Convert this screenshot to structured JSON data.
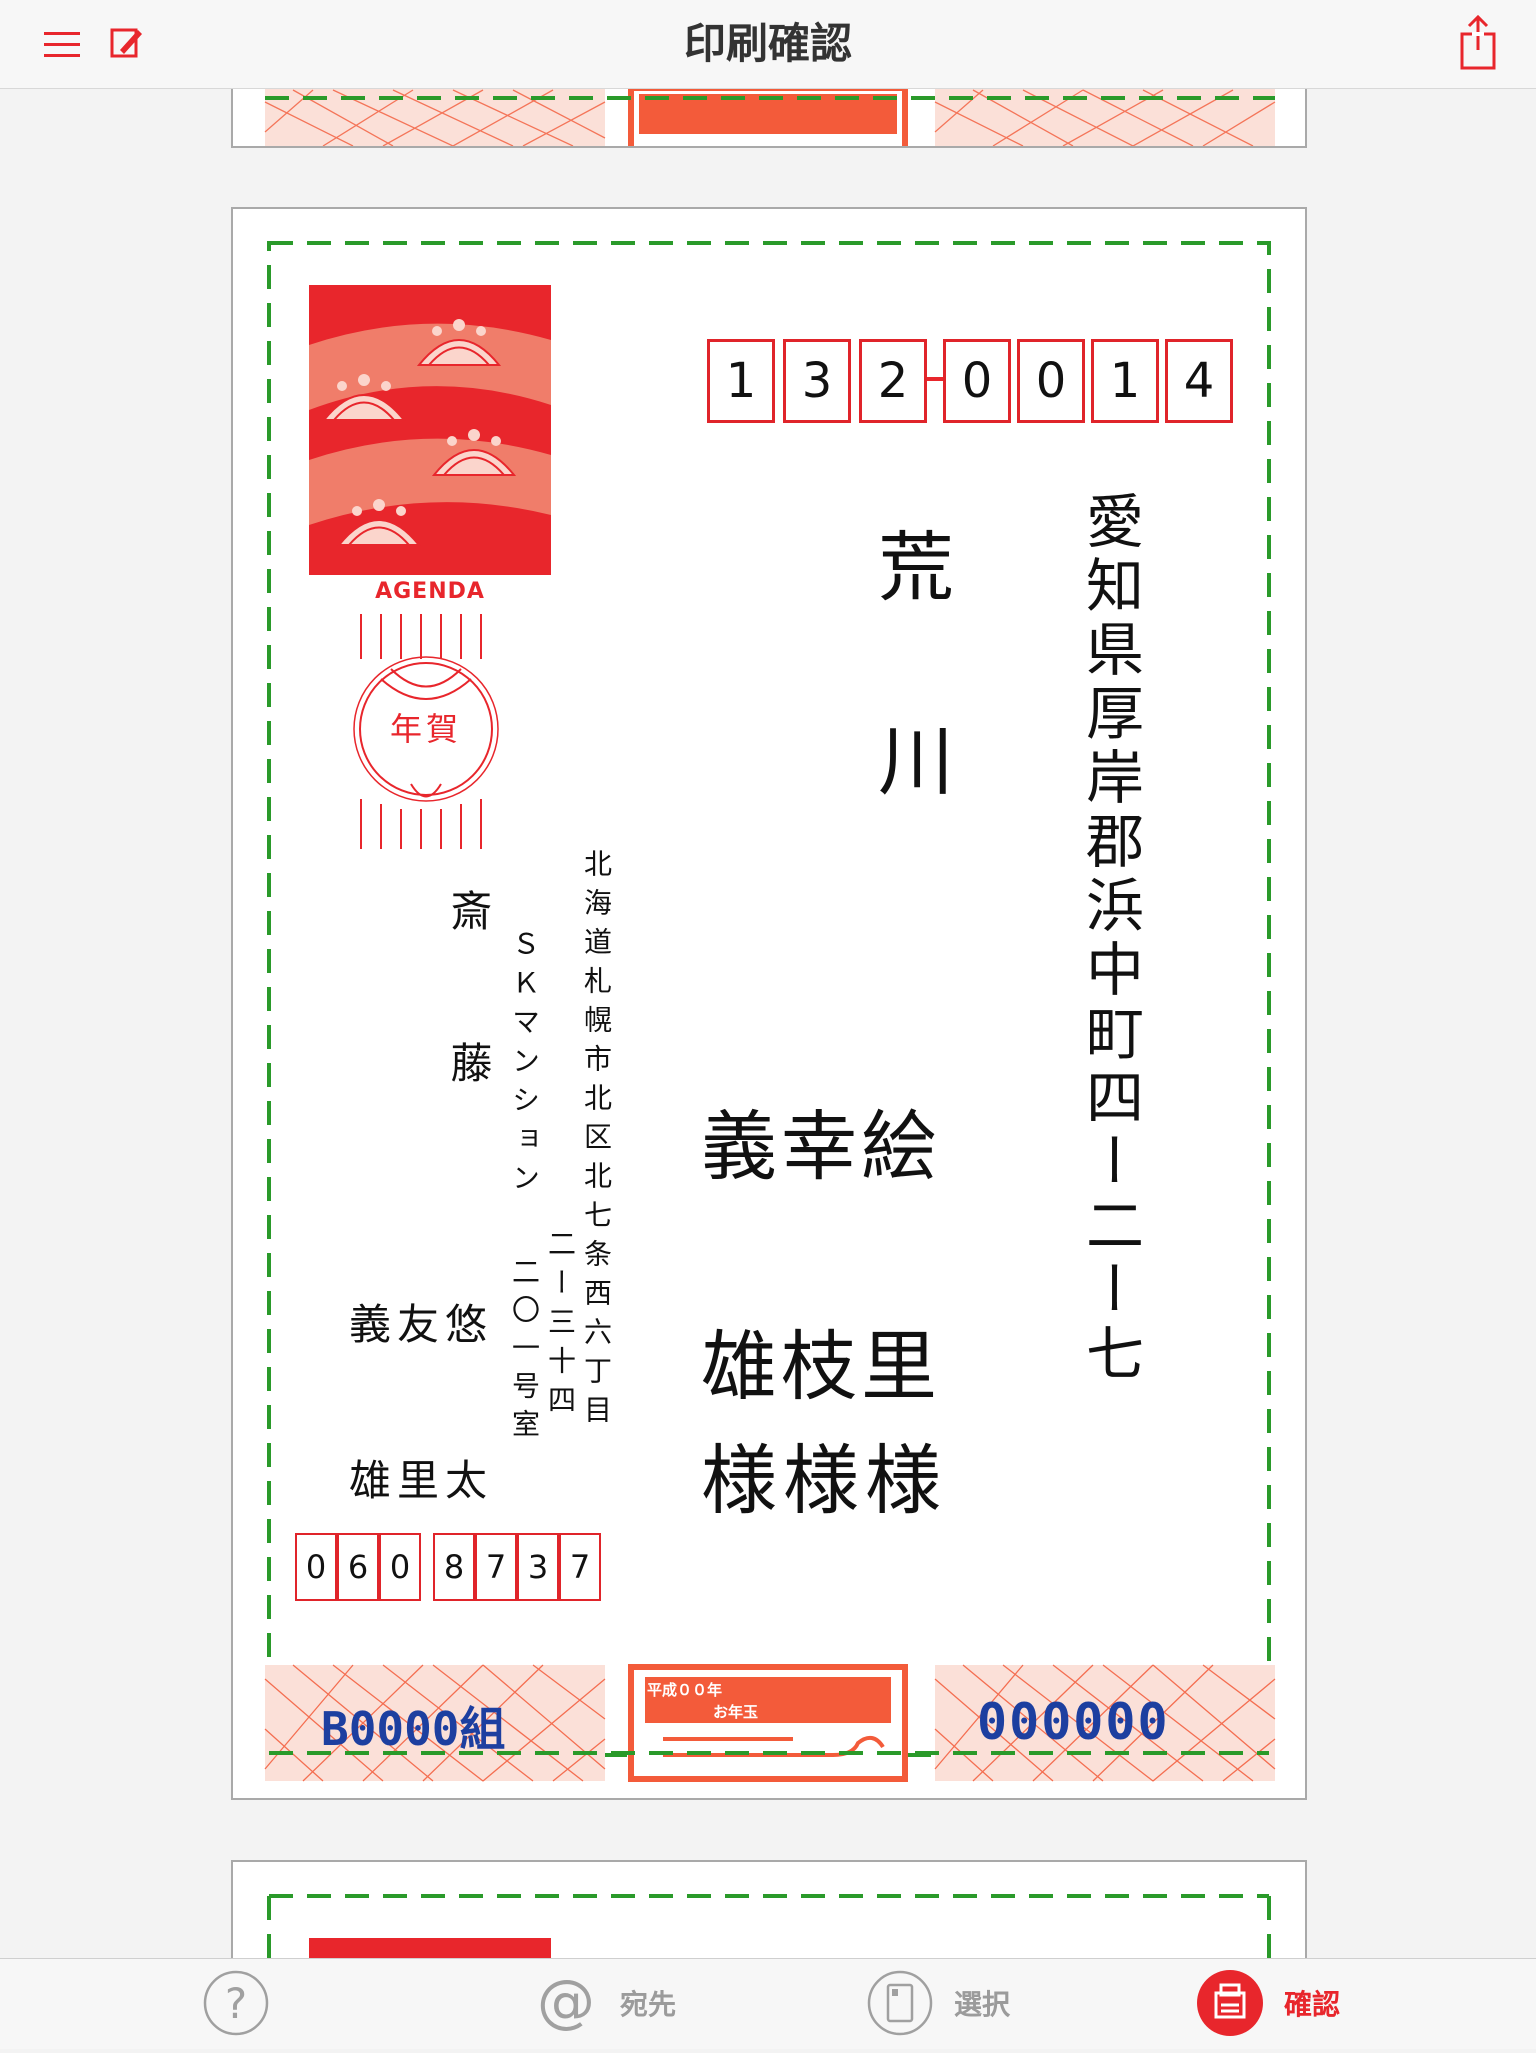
{
  "header": {
    "title": "印刷確認"
  },
  "address": {
    "recipient_zip": [
      "1",
      "3",
      "2",
      "0",
      "0",
      "1",
      "4"
    ],
    "recipient_address": "愛知県厚岸郡浜中町四ー二ー七",
    "recipient_surname": "荒川",
    "recipient_given_1": "義幸絵",
    "recipient_given_2": "雄枝里",
    "honorific_1": "様",
    "honorific_2": "様",
    "honorific_3": "様",
    "sender_address_1": "北海道札幌市北区北七条西六丁目",
    "sender_address_2": "二ー三十四",
    "sender_building": "ＳＫマンション",
    "sender_room": "二〇一号室",
    "sender_surname": "斎藤",
    "sender_given_1": "義友悠",
    "sender_given_2": "雄里太",
    "sender_zip": [
      "0",
      "6",
      "0",
      "8",
      "7",
      "3",
      "7"
    ]
  },
  "stamp": {
    "brand": "AGENDA",
    "nenga": "年賀"
  },
  "lottery": {
    "group": "B0000組",
    "number": "000000",
    "heisei": "平成００年",
    "otoshidama": "お年玉"
  },
  "tabbar": {
    "help_label": "",
    "address_label": "宛先",
    "select_label": "選択",
    "confirm_label": "確認"
  },
  "colors": {
    "accent": "#e8262c",
    "guide_green": "#2a9a2a",
    "number_blue": "#1d3fa0"
  }
}
